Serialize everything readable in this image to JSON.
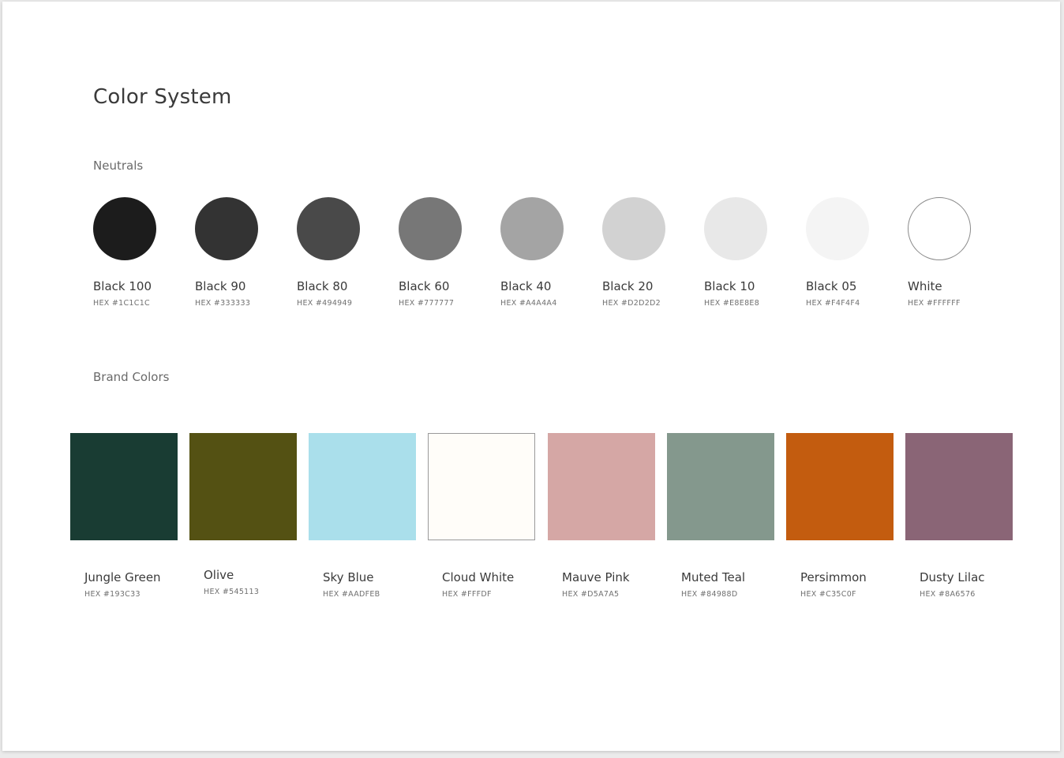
{
  "page": {
    "title": "Color System",
    "neutrals_label": "Neutrals",
    "brand_label": "Brand Colors"
  },
  "neutrals": [
    {
      "name": "Black 100",
      "hex_label": "HEX #1C1C1C",
      "color": "#1C1C1C"
    },
    {
      "name": "Black 90",
      "hex_label": "HEX #333333",
      "color": "#333333"
    },
    {
      "name": "Black 80",
      "hex_label": "HEX #494949",
      "color": "#494949"
    },
    {
      "name": "Black 60",
      "hex_label": "HEX #777777",
      "color": "#777777"
    },
    {
      "name": "Black 40",
      "hex_label": "HEX #A4A4A4",
      "color": "#A4A4A4"
    },
    {
      "name": "Black 20",
      "hex_label": "HEX #D2D2D2",
      "color": "#D2D2D2"
    },
    {
      "name": "Black 10",
      "hex_label": "HEX #E8E8E8",
      "color": "#E8E8E8"
    },
    {
      "name": "Black 05",
      "hex_label": "HEX #F4F4F4",
      "color": "#F4F4F4"
    },
    {
      "name": "White",
      "hex_label": "HEX #FFFFFF",
      "color": "#FFFFFF"
    }
  ],
  "brand_colors": [
    {
      "name": "Jungle Green",
      "hex_label": "HEX #193C33",
      "color": "#193C33"
    },
    {
      "name": "Olive",
      "hex_label": "HEX #545113",
      "color": "#545113"
    },
    {
      "name": "Sky Blue",
      "hex_label": "HEX #AADFEB",
      "color": "#AADFEB"
    },
    {
      "name": "Cloud White",
      "hex_label": "HEX #FFFDF",
      "color": "#FFFDF9"
    },
    {
      "name": "Mauve Pink",
      "hex_label": "HEX #D5A7A5",
      "color": "#D5A7A5"
    },
    {
      "name": "Muted Teal",
      "hex_label": "HEX #84988D",
      "color": "#84988D"
    },
    {
      "name": "Persimmon",
      "hex_label": "HEX #C35C0F",
      "color": "#C35C0F"
    },
    {
      "name": "Dusty Lilac",
      "hex_label": "HEX #8A6576",
      "color": "#8A6576"
    }
  ]
}
